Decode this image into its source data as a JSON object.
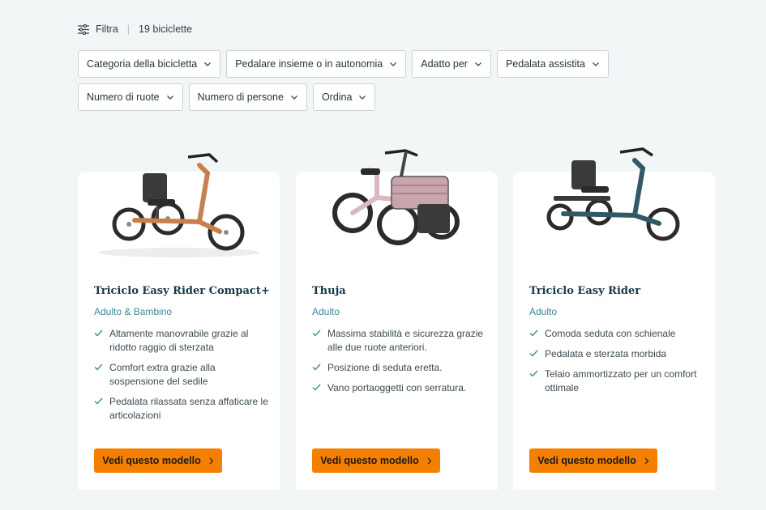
{
  "toolbar": {
    "filter_label": "Filtra",
    "separator": "|",
    "count_label": "19 biciclette"
  },
  "filters": {
    "row1": [
      {
        "label": "Categoria della bicicletta"
      },
      {
        "label": "Pedalare insieme o in autonomia"
      },
      {
        "label": "Adatto per"
      },
      {
        "label": "Pedalata assistita"
      }
    ],
    "row2": [
      {
        "label": "Numero di ruote"
      },
      {
        "label": "Numero di persone"
      },
      {
        "label": "Ordina"
      }
    ]
  },
  "products": [
    {
      "title": "Triciclo Easy Rider Compact+",
      "subtitle": "Adulto & Bambino",
      "features": [
        "Altamente manovrabile grazie al ridotto raggio di sterzata",
        "Comfort extra grazie alla sospensione del sedile",
        "Pedalata rilassata senza affaticare le articolazioni"
      ],
      "cta": "Vedi questo modello",
      "frame_color": "#c8814e"
    },
    {
      "title": "Thuja",
      "subtitle": "Adulto",
      "features": [
        "Massima stabilità e sicurezza grazie alle due ruote anteriori.",
        "Posizione di seduta eretta.",
        "Vano portaoggetti con serratura."
      ],
      "cta": "Vedi questo modello",
      "frame_color": "#d9b9bf"
    },
    {
      "title": "Triciclo Easy Rider",
      "subtitle": "Adulto",
      "features": [
        "Comoda seduta con schienale",
        "Pedalata e sterzata morbida",
        "Telaio ammortizzato per un comfort ottimale"
      ],
      "cta": "Vedi questo modello",
      "frame_color": "#2f5a66"
    }
  ],
  "colors": {
    "accent": "#f57f00",
    "title": "#17384b",
    "subtitle": "#3f8697",
    "check": "#3f8697"
  }
}
